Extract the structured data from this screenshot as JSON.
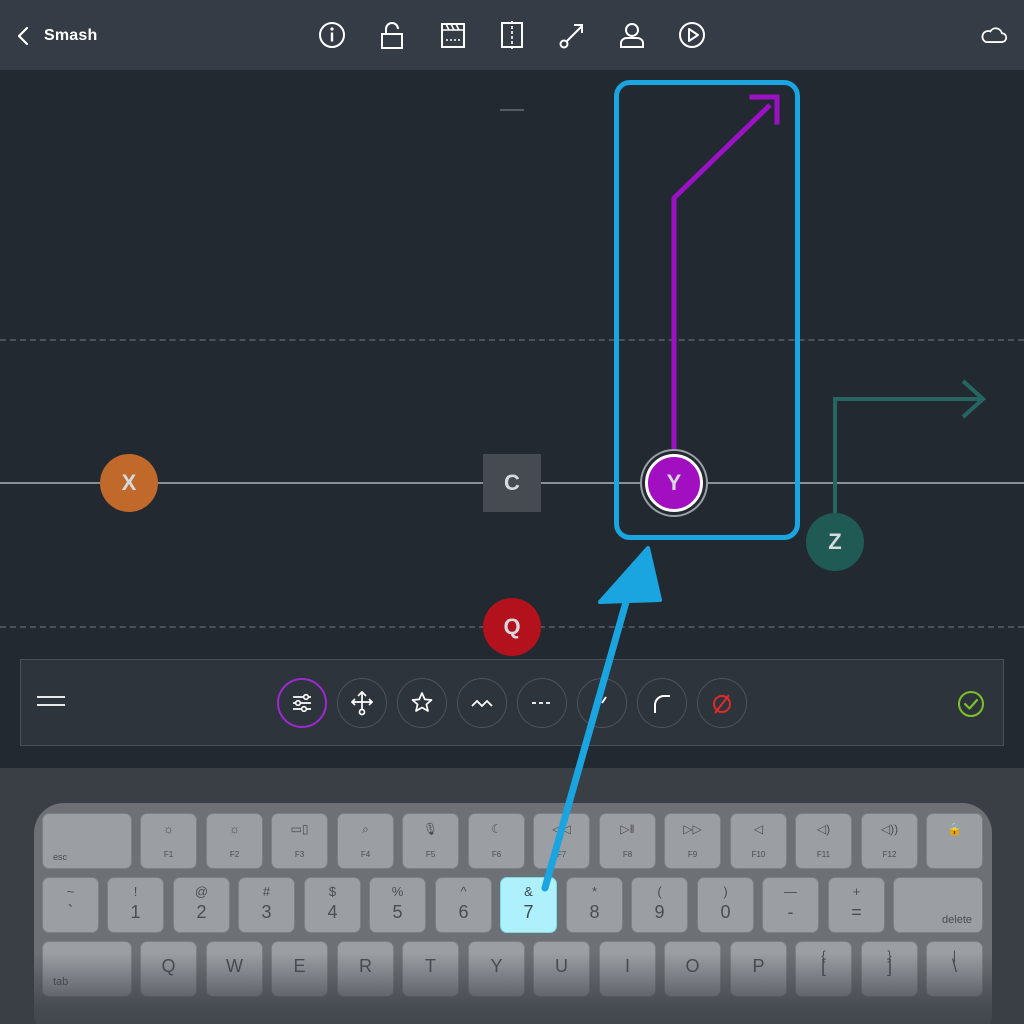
{
  "app": {
    "back_label": "Smash"
  },
  "toolbar_icons": [
    "info-icon",
    "unlock-icon",
    "clapperboard-icon",
    "split-icon",
    "route-icon",
    "person-icon",
    "play-icon",
    "cloud-icon"
  ],
  "players": {
    "x": {
      "label": "X",
      "color": "#c0692a"
    },
    "c": {
      "label": "C",
      "color": "#464b52"
    },
    "y": {
      "label": "Y",
      "color": "#a10fc0"
    },
    "z": {
      "label": "Z",
      "color": "#1f5a55"
    },
    "q": {
      "label": "Q",
      "color": "#b3121d"
    }
  },
  "route_colors": {
    "y": "#9a12c4",
    "z": "#256660"
  },
  "highlight_color": "#1aa4e0",
  "tools": [
    "settings-sliders-icon",
    "move-icon",
    "star-icon",
    "zigzag-icon",
    "dashed-line-icon",
    "curve-icon",
    "corner-icon",
    "none-icon"
  ],
  "keyboard": {
    "fn_row": [
      {
        "top": "",
        "fn": "esc"
      },
      {
        "glyph": "☼",
        "fn": "F1"
      },
      {
        "glyph": "☼",
        "fn": "F2"
      },
      {
        "glyph": "▭▯",
        "fn": "F3"
      },
      {
        "glyph": "⌕",
        "fn": "F4"
      },
      {
        "glyph": "🎙",
        "fn": "F5"
      },
      {
        "glyph": "☾",
        "fn": "F6"
      },
      {
        "glyph": "◁◁",
        "fn": "F7"
      },
      {
        "glyph": "▷‖",
        "fn": "F8"
      },
      {
        "glyph": "▷▷",
        "fn": "F9"
      },
      {
        "glyph": "◁",
        "fn": "F10"
      },
      {
        "glyph": "◁)",
        "fn": "F11"
      },
      {
        "glyph": "◁))",
        "fn": "F12"
      },
      {
        "glyph": "🔒",
        "fn": ""
      }
    ],
    "num_row": [
      {
        "top": "~",
        "bot": "`"
      },
      {
        "top": "!",
        "bot": "1"
      },
      {
        "top": "@",
        "bot": "2"
      },
      {
        "top": "#",
        "bot": "3"
      },
      {
        "top": "$",
        "bot": "4"
      },
      {
        "top": "%",
        "bot": "5"
      },
      {
        "top": "^",
        "bot": "6"
      },
      {
        "top": "&",
        "bot": "7"
      },
      {
        "top": "*",
        "bot": "8"
      },
      {
        "top": "(",
        "bot": "9"
      },
      {
        "top": ")",
        "bot": "0"
      },
      {
        "top": "—",
        "bot": "-"
      },
      {
        "top": "+",
        "bot": "="
      },
      {
        "top": "",
        "bot": "delete"
      }
    ],
    "letter_row": [
      {
        "bot": "tab"
      },
      {
        "bot": "Q"
      },
      {
        "bot": "W"
      },
      {
        "bot": "E"
      },
      {
        "bot": "R"
      },
      {
        "bot": "T"
      },
      {
        "bot": "Y"
      },
      {
        "bot": "U"
      },
      {
        "bot": "I"
      },
      {
        "bot": "O"
      },
      {
        "bot": "P"
      },
      {
        "top": "{",
        "bot": "["
      },
      {
        "top": "}",
        "bot": "]"
      },
      {
        "top": "|",
        "bot": "\\"
      }
    ],
    "active_key": "7"
  }
}
